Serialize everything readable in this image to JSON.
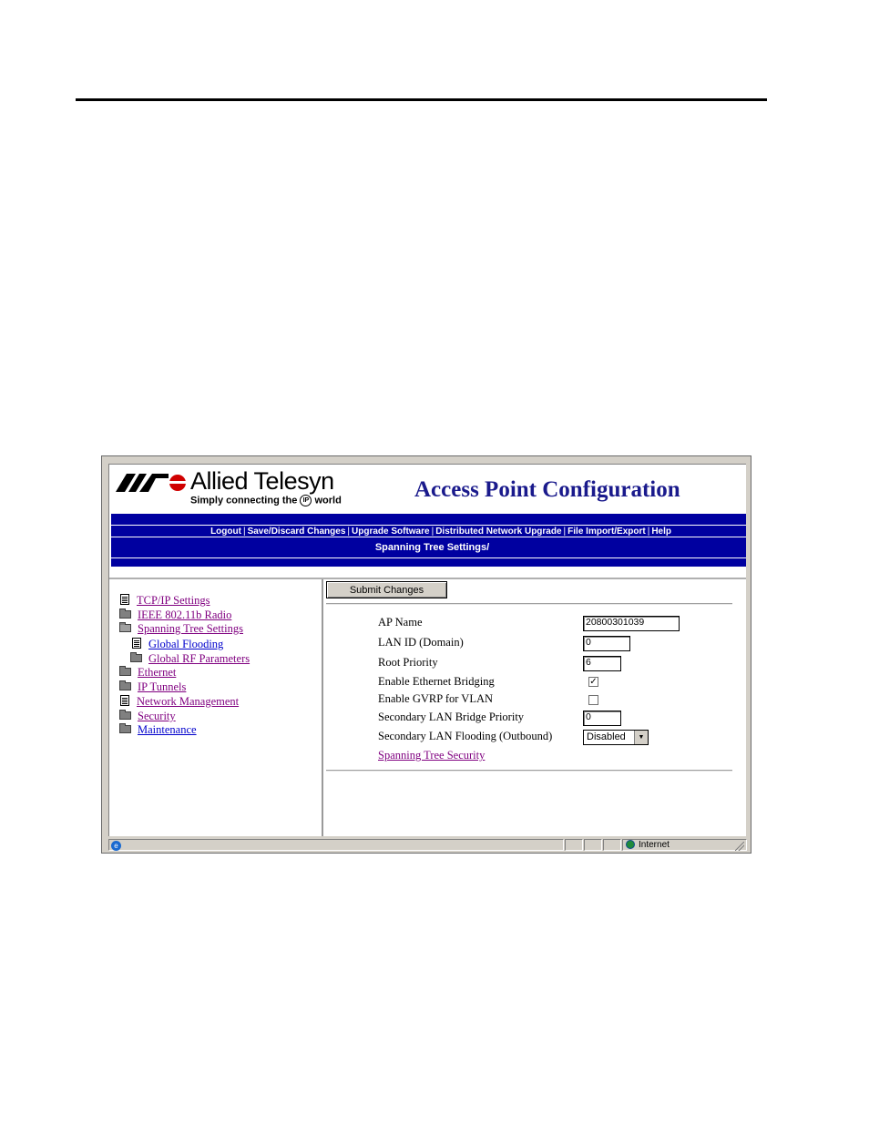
{
  "app": {
    "brand_name": "Allied Telesyn",
    "brand_tagline_before": "Simply connecting the",
    "brand_tagline_badge": "IP",
    "brand_tagline_after": "world",
    "title": "Access Point Configuration"
  },
  "nav": {
    "links": [
      "Logout",
      "Save/Discard Changes",
      "Upgrade Software",
      "Distributed Network Upgrade",
      "File Import/Export",
      "Help"
    ],
    "separator": "|",
    "page_title": "Spanning Tree Settings/"
  },
  "tree": {
    "items": [
      {
        "label": "TCP/IP Settings",
        "icon": "document-icon"
      },
      {
        "label": "IEEE 802.11b Radio",
        "icon": "folder-icon"
      },
      {
        "label": "Spanning Tree Settings",
        "icon": "open-folder-icon"
      },
      {
        "label": "Global Flooding",
        "icon": "document-icon"
      },
      {
        "label": "Global RF Parameters",
        "icon": "folder-icon"
      },
      {
        "label": "Ethernet",
        "icon": "folder-icon"
      },
      {
        "label": "IP Tunnels",
        "icon": "folder-icon"
      },
      {
        "label": "Network Management",
        "icon": "document-icon"
      },
      {
        "label": "Security",
        "icon": "folder-icon"
      },
      {
        "label": "Maintenance",
        "icon": "folder-icon"
      }
    ]
  },
  "form": {
    "submit_label": "Submit Changes",
    "ap_name": {
      "label": "AP Name",
      "value": "20800301039"
    },
    "lan_id": {
      "label": "LAN ID (Domain)",
      "value": "0"
    },
    "root_priority": {
      "label": "Root Priority",
      "value": "6"
    },
    "ethernet_bridging": {
      "label": "Enable Ethernet Bridging",
      "mark": "✓"
    },
    "gvrp": {
      "label": "Enable GVRP for VLAN",
      "mark": ""
    },
    "secondary_bridge_priority": {
      "label": "Secondary LAN Bridge Priority",
      "value": "0"
    },
    "secondary_flooding": {
      "label": "Secondary LAN Flooding (Outbound)",
      "value": "Disabled"
    },
    "security_link": "Spanning Tree Security"
  },
  "status": {
    "zone": "Internet"
  },
  "colors": {
    "nav_band": "#0000a0",
    "title": "#1a1a8c",
    "visited_link": "#800080",
    "link": "#0000cc"
  }
}
